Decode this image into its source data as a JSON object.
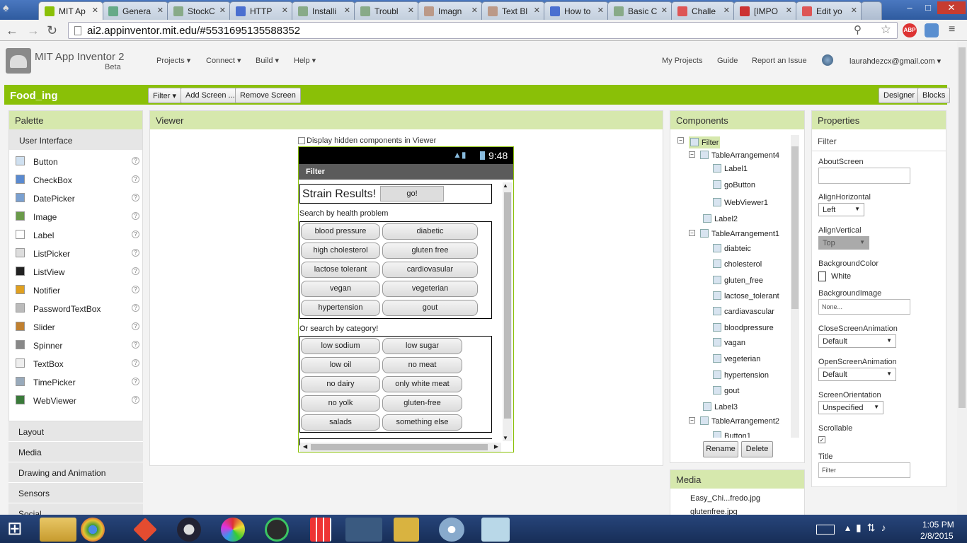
{
  "browser": {
    "tabs": [
      {
        "label": "MIT Ap",
        "color": "#8ac007"
      },
      {
        "label": "Genera",
        "color": "#6a8"
      },
      {
        "label": "StockC",
        "color": "#8a8"
      },
      {
        "label": "HTTP",
        "color": "#4a6fd0"
      },
      {
        "label": "Installi",
        "color": "#8a8"
      },
      {
        "label": "Troubl",
        "color": "#8a8"
      },
      {
        "label": "Imagn",
        "color": "#b98"
      },
      {
        "label": "Text Bl",
        "color": "#b98"
      },
      {
        "label": "How to",
        "color": "#4a6fd0"
      },
      {
        "label": "Basic C",
        "color": "#8a8"
      },
      {
        "label": "Challe",
        "color": "#d55"
      },
      {
        "label": "[IMPO",
        "color": "#c33"
      },
      {
        "label": "Edit yo",
        "color": "#d55"
      }
    ],
    "url": "ai2.appinventor.mit.edu/#5531695135588352"
  },
  "app": {
    "name": "MIT App Inventor 2",
    "beta": "Beta",
    "menus": [
      "Projects ▾",
      "Connect ▾",
      "Build ▾",
      "Help ▾"
    ],
    "right_links": [
      "My Projects",
      "Guide",
      "Report an Issue"
    ],
    "user": "laurahdezcx@gmail.com ▾",
    "project": "Food_ing",
    "screen_btn": "Filter ▾",
    "add_screen": "Add Screen ...",
    "remove_screen": "Remove Screen",
    "designer": "Designer",
    "blocks": "Blocks"
  },
  "palette": {
    "title": "Palette",
    "section": "User Interface",
    "items": [
      {
        "label": "Button",
        "icon": "button-icon"
      },
      {
        "label": "CheckBox",
        "icon": "checkbox-icon"
      },
      {
        "label": "DatePicker",
        "icon": "datepicker-icon"
      },
      {
        "label": "Image",
        "icon": "image-icon"
      },
      {
        "label": "Label",
        "icon": "label-icon"
      },
      {
        "label": "ListPicker",
        "icon": "listpicker-icon"
      },
      {
        "label": "ListView",
        "icon": "listview-icon"
      },
      {
        "label": "Notifier",
        "icon": "notifier-icon"
      },
      {
        "label": "PasswordTextBox",
        "icon": "password-icon"
      },
      {
        "label": "Slider",
        "icon": "slider-icon"
      },
      {
        "label": "Spinner",
        "icon": "spinner-icon"
      },
      {
        "label": "TextBox",
        "icon": "textbox-icon"
      },
      {
        "label": "TimePicker",
        "icon": "timepicker-icon"
      },
      {
        "label": "WebViewer",
        "icon": "webviewer-icon"
      }
    ],
    "categories": [
      "Layout",
      "Media",
      "Drawing and Animation",
      "Sensors",
      "Social"
    ]
  },
  "viewer": {
    "title": "Viewer",
    "hidden_chk": "Display hidden components in Viewer",
    "time": "9:48",
    "screen_title": "Filter",
    "strain": "Strain Results!",
    "go": "go!",
    "health_label": "Search by health problem",
    "health": [
      [
        "blood pressure",
        "diabetic"
      ],
      [
        "high cholesterol",
        "gluten free"
      ],
      [
        "lactose tolerant",
        "cardiovasular"
      ],
      [
        "vegan",
        "vegeterian"
      ],
      [
        "hypertension",
        "gout"
      ]
    ],
    "cat_label": "Or search by category!",
    "cats": [
      [
        "low sodium",
        "low sugar"
      ],
      [
        "low oil",
        "no meat"
      ],
      [
        "no dairy",
        "only white meat"
      ],
      [
        "no yolk",
        "gluten-free"
      ],
      [
        "salads",
        "something else"
      ]
    ]
  },
  "components": {
    "title": "Components",
    "tree": [
      "Filter",
      "TableArrangement4",
      "Label1",
      "goButton",
      "WebViewer1",
      "Label2",
      "TableArrangement1",
      "diabteic",
      "cholesterol",
      "gluten_free",
      "lactose_tolerant",
      "cardiavascular",
      "bloodpressure",
      "vagan",
      "vegeterian",
      "hypertension",
      "gout",
      "Label3",
      "TableArrangement2",
      "Button1"
    ],
    "rename": "Rename",
    "delete": "Delete"
  },
  "media": {
    "title": "Media",
    "files": [
      "Easy_Chi...fredo.jpg",
      "glutenfree.jpg"
    ]
  },
  "properties": {
    "title": "Properties",
    "component": "Filter",
    "about": "AboutScreen",
    "align_h": "AlignHorizontal",
    "align_h_val": "Left",
    "align_v": "AlignVertical",
    "align_v_val": "Top",
    "bg_color": "BackgroundColor",
    "bg_color_val": "White",
    "bg_image": "BackgroundImage",
    "bg_image_val": "None...",
    "close_anim": "CloseScreenAnimation",
    "close_anim_val": "Default",
    "open_anim": "OpenScreenAnimation",
    "open_anim_val": "Default",
    "orientation": "ScreenOrientation",
    "orientation_val": "Unspecified",
    "scrollable": "Scrollable",
    "title_lbl": "Title",
    "title_val": "Filter"
  },
  "taskbar": {
    "time": "1:05 PM",
    "date": "2/8/2015"
  }
}
